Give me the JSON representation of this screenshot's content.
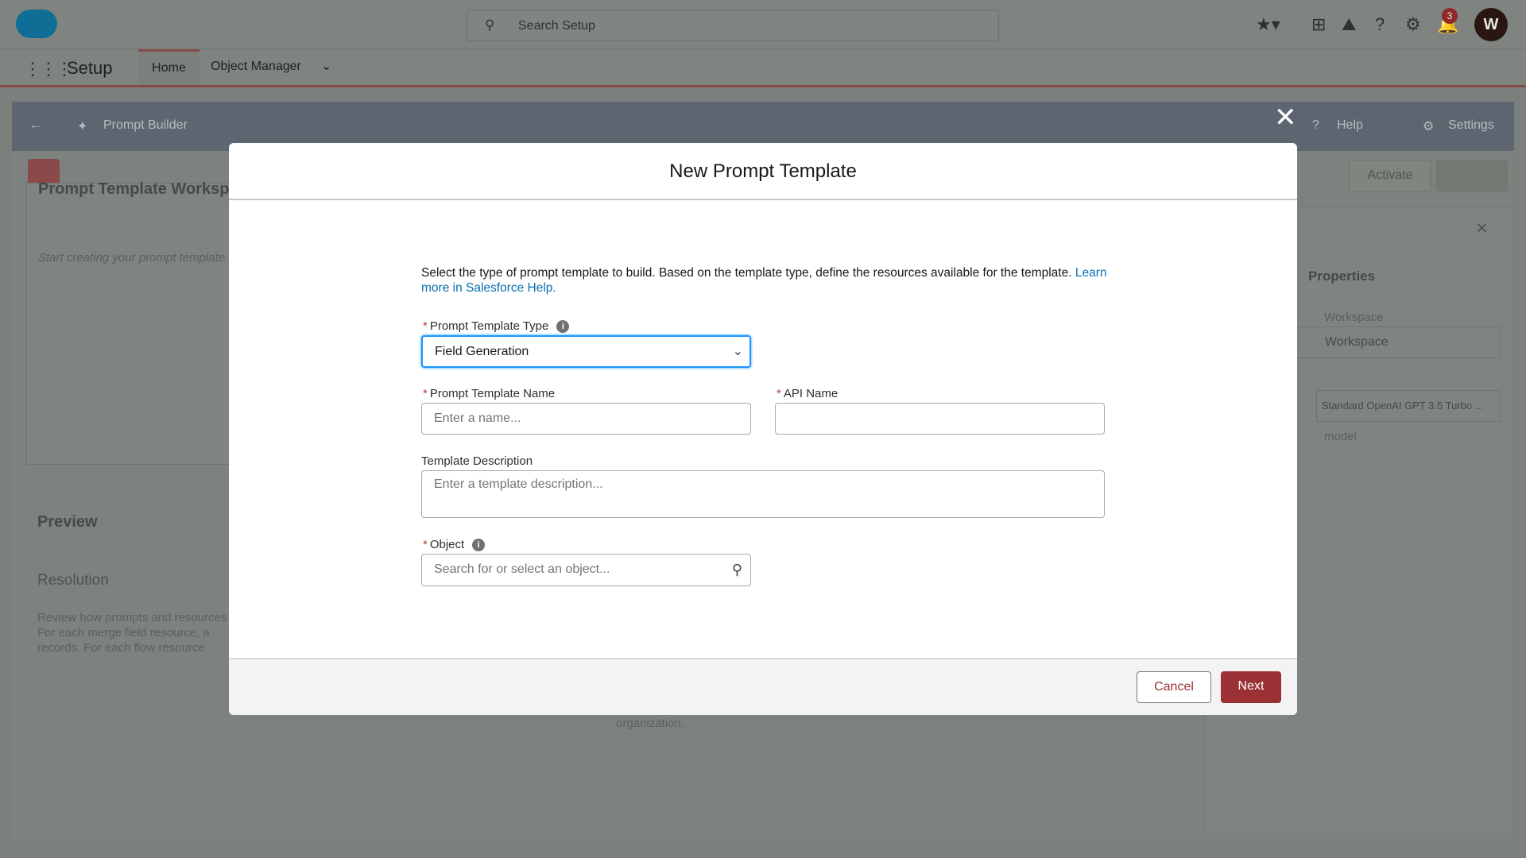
{
  "header": {
    "search_placeholder": "Search Setup",
    "notification_count": "3",
    "avatar_initial": "W"
  },
  "nav": {
    "app_name": "Setup",
    "tabs": [
      {
        "label": "Home",
        "active": true
      },
      {
        "label": "Object Manager"
      }
    ]
  },
  "builder": {
    "title": "Prompt Builder",
    "help": "Help",
    "settings": "Settings",
    "activate": "Activate"
  },
  "background": {
    "workspace_title": "Prompt Template Workspace",
    "workspace_placeholder": "Start creating your prompt template",
    "preview": "Preview",
    "resolution": "Resolution",
    "resolution_text": [
      "Review how prompts and resources",
      "For each merge field resource, a",
      "records. For each flow resource"
    ],
    "organization": "organization.",
    "properties": "Properties",
    "workspace_label": "Workspace",
    "workspace_value": "Workspace",
    "model_value": "Standard OpenAI GPT 3.5 Turbo ...",
    "model_link": "model"
  },
  "modal": {
    "title": "New Prompt Template",
    "intro": "Select the type of prompt template to build. Based on the template type, define the resources available for the template.",
    "intro_link": "Learn more in Salesforce Help.",
    "type_label": "Prompt Template Type",
    "type_value": "Field Generation",
    "name_label": "Prompt Template Name",
    "name_placeholder": "Enter a name...",
    "api_label": "API Name",
    "api_value": "",
    "desc_label": "Template Description",
    "desc_placeholder": "Enter a template description...",
    "object_label": "Object",
    "object_placeholder": "Search for or select an object...",
    "cancel": "Cancel",
    "next": "Next"
  },
  "colors": {
    "brand": "#0d9dda",
    "accent": "#9b3135",
    "link": "#0b6fb0",
    "focus": "#1b96ff"
  }
}
